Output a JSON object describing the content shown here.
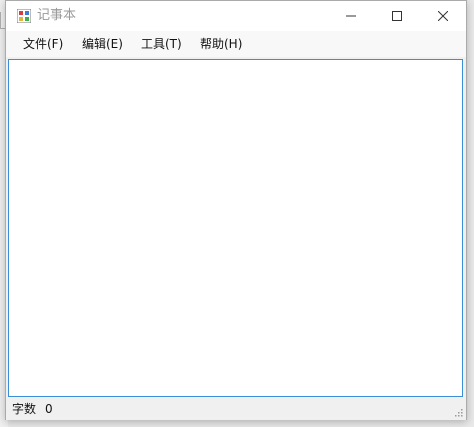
{
  "window": {
    "title": "记事本",
    "app_icon": "notepad-app-icon"
  },
  "title_buttons": {
    "minimize_icon": "minimize-icon",
    "maximize_icon": "maximize-icon",
    "close_icon": "close-icon"
  },
  "menu": {
    "items": [
      {
        "label": "文件(F)"
      },
      {
        "label": "编辑(E)"
      },
      {
        "label": "工具(T)"
      },
      {
        "label": "帮助(H)"
      }
    ]
  },
  "editor": {
    "value": ""
  },
  "statusbar": {
    "word_count_label": "字数",
    "word_count_value": "0",
    "grip_icon": "resize-grip-icon"
  },
  "colors": {
    "editor_border": "#3c8fd6",
    "title_text": "#9a9a9a"
  }
}
